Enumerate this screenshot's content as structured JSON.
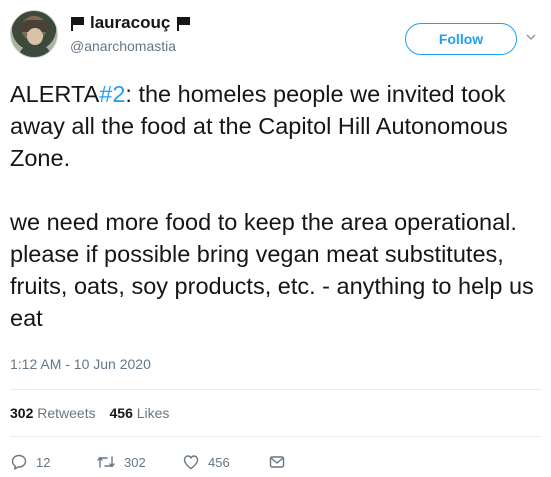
{
  "user": {
    "display_name": "lauracouç",
    "handle": "@anarchomastia"
  },
  "follow_label": "Follow",
  "tweet": {
    "hashtag_prefix": "ALERTA",
    "hashtag": "#2",
    "line1_rest": ": the homeles people we invited took away all the food at the Capitol Hill Autonomous Zone.",
    "paragraph2": "we need more food to keep the area operational. please if possible bring vegan meat substitutes, fruits, oats, soy products, etc. - anything to help us eat"
  },
  "timestamp": "1:12 AM - 10 Jun 2020",
  "stats": {
    "retweets_count": "302",
    "retweets_label": "Retweets",
    "likes_count": "456",
    "likes_label": "Likes"
  },
  "actions": {
    "reply_count": "12",
    "retweet_count": "302",
    "like_count": "456"
  },
  "colors": {
    "accent": "#1da1f2",
    "muted": "#657786",
    "text": "#14171a",
    "divider": "#e6ecf0"
  },
  "icons": [
    "flag-icon",
    "chevron-down-icon",
    "reply-icon",
    "retweet-icon",
    "heart-icon",
    "message-icon"
  ]
}
